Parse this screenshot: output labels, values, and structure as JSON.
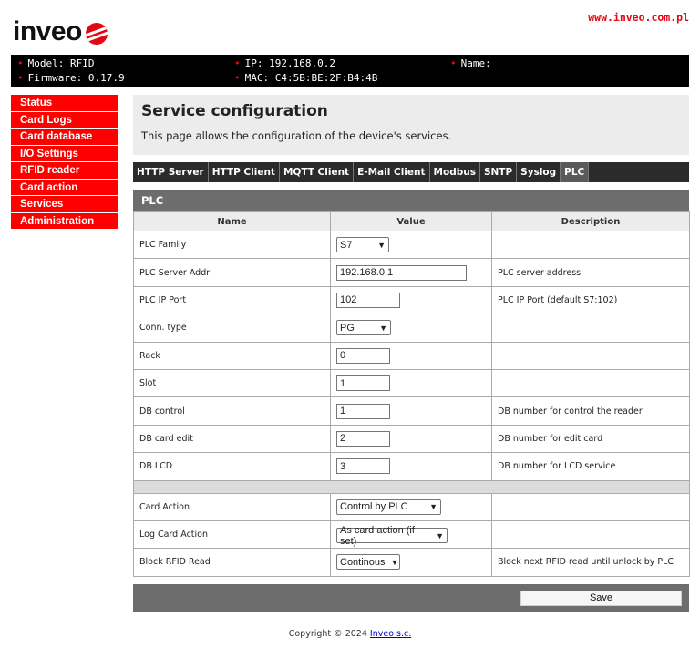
{
  "header": {
    "logo_text": "inveo",
    "site_link": "www.inveo.com.pl"
  },
  "info": {
    "model": "Model: RFID",
    "firmware": "Firmware: 0.17.9",
    "ip": "IP: 192.168.0.2",
    "mac": "MAC: C4:5B:BE:2F:B4:4B",
    "name": "Name:"
  },
  "sidebar": {
    "items": [
      "Status",
      "Card Logs",
      "Card database",
      "I/O Settings",
      "RFID reader",
      "Card action",
      "Services",
      "Administration"
    ]
  },
  "page": {
    "title": "Service configuration",
    "description": "This page allows the configuration of the device's services."
  },
  "tabs": [
    "HTTP Server",
    "HTTP Client",
    "MQTT Client",
    "E-Mail Client",
    "Modbus",
    "SNTP",
    "Syslog",
    "PLC"
  ],
  "active_tab": "PLC",
  "section_title": "PLC",
  "table": {
    "headers": {
      "name": "Name",
      "value": "Value",
      "description": "Description"
    },
    "rows": [
      {
        "name": "PLC Family",
        "value": "S7",
        "description": ""
      },
      {
        "name": "PLC Server Addr",
        "value": "192.168.0.1",
        "description": "PLC server address"
      },
      {
        "name": "PLC IP Port",
        "value": "102",
        "description": "PLC IP Port (default S7:102)"
      },
      {
        "name": "Conn. type",
        "value": "PG",
        "description": ""
      },
      {
        "name": "Rack",
        "value": "0",
        "description": ""
      },
      {
        "name": "Slot",
        "value": "1",
        "description": ""
      },
      {
        "name": "DB control",
        "value": "1",
        "description": "DB number for control the reader"
      },
      {
        "name": "DB card edit",
        "value": "2",
        "description": "DB number for edit card"
      },
      {
        "name": "DB LCD",
        "value": "3",
        "description": "DB number for LCD service"
      },
      {
        "name": "Card Action",
        "value": "Control by PLC",
        "description": ""
      },
      {
        "name": "Log Card Action",
        "value": "As card action (if set)",
        "description": ""
      },
      {
        "name": "Block RFID Read",
        "value": "Continous",
        "description": "Block next RFID read until unlock by PLC"
      }
    ]
  },
  "save_label": "Save",
  "footer": {
    "copyright": "Copyright © 2024",
    "company": "Inveo s.c."
  },
  "colors": {
    "accent": "#ff0000",
    "infobar": "#000000",
    "tabbar": "#2b2b2b",
    "section": "#6d6d6d"
  }
}
